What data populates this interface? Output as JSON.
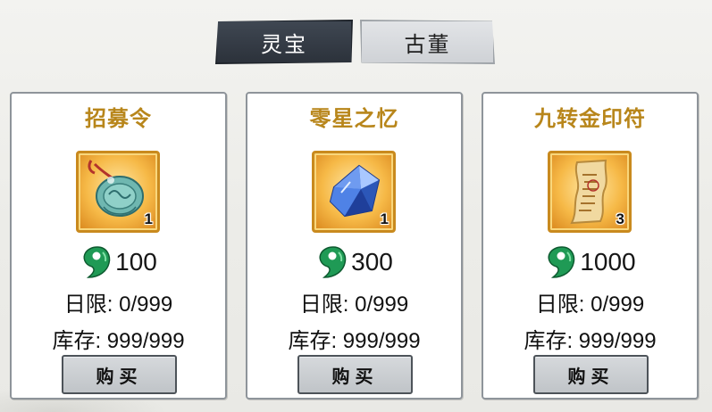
{
  "tabs": [
    {
      "label": "灵宝",
      "active": true
    },
    {
      "label": "古董",
      "active": false
    }
  ],
  "items": [
    {
      "name": "招募令",
      "icon": "jade-token-icon",
      "quantity": "1",
      "price": "100",
      "daily": "日限: 0/999",
      "stock": "库存: 999/999",
      "buy_label": "购买"
    },
    {
      "name": "零星之忆",
      "icon": "blue-crystal-icon",
      "quantity": "1",
      "price": "300",
      "daily": "日限: 0/999",
      "stock": "库存: 999/999",
      "buy_label": "购买"
    },
    {
      "name": "九转金印符",
      "icon": "talisman-scroll-icon",
      "quantity": "3",
      "price": "1000",
      "daily": "日限: 0/999",
      "stock": "库存: 999/999",
      "buy_label": "购买"
    }
  ],
  "colors": {
    "title": "#b8861b",
    "jade": "#1f9a55",
    "tab_active": "#2c323b",
    "tab_inactive": "#cfd2d6"
  }
}
